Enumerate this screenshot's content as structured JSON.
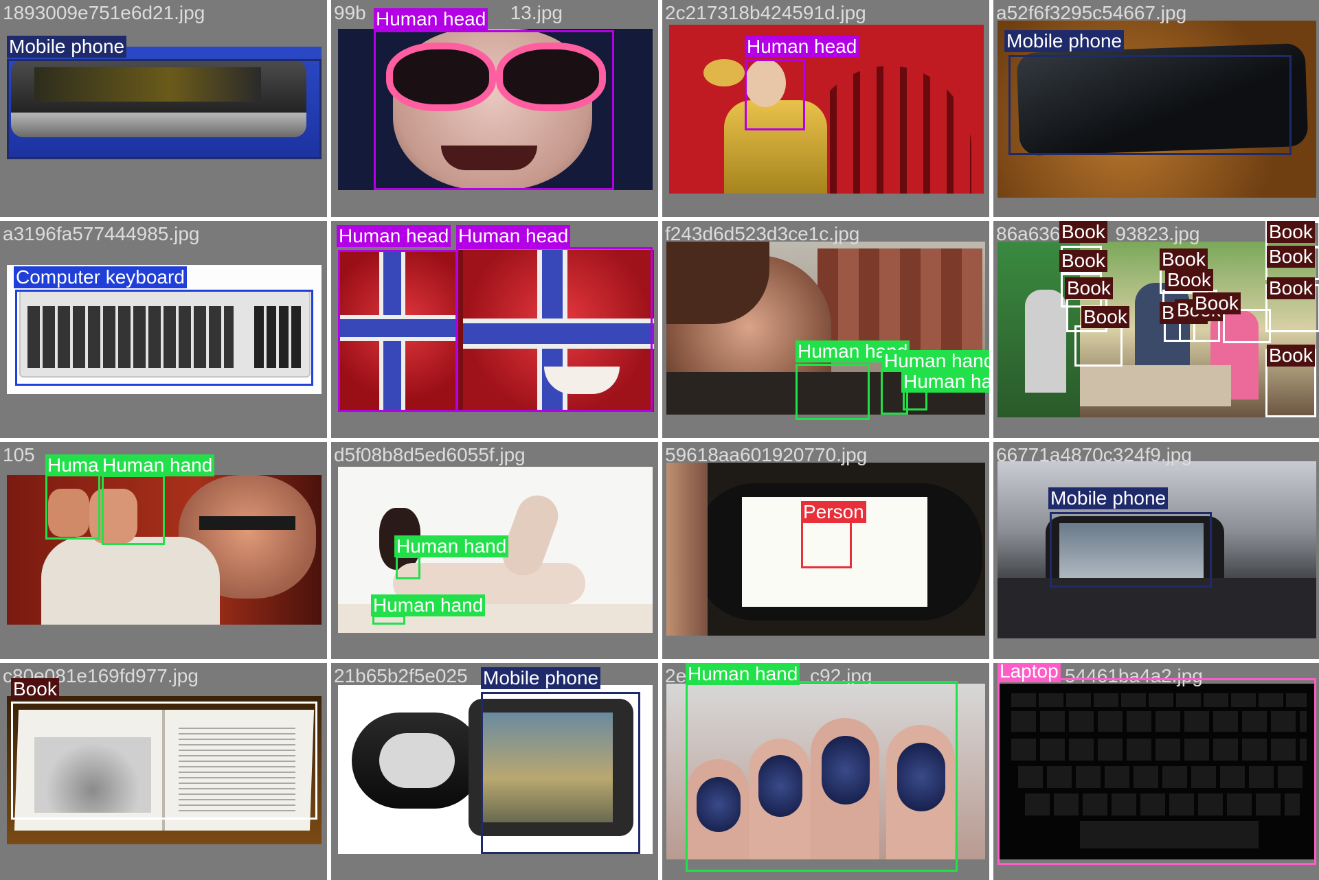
{
  "colors": {
    "mobile_phone": "#1f2a6b",
    "human_head": "#b400e6",
    "computer_keyboard": "#1f3fd8",
    "human_hand": "#22e04a",
    "book": "#4d1010",
    "person": "#e8303a",
    "laptop": "#ff5cc8"
  },
  "tiles": [
    {
      "filename": "1893009e751e6d21.jpg",
      "labels": [
        "Mobile phone"
      ]
    },
    {
      "filename": "99b",
      "filename_tail": "13.jpg",
      "labels": [
        "Human head"
      ]
    },
    {
      "filename": "2c217318b424591d.jpg",
      "labels": [
        "Human head"
      ]
    },
    {
      "filename": "a52f6f3295c54667.jpg",
      "labels": [
        "Mobile phone"
      ]
    },
    {
      "filename": "a3196fa577444985.jpg",
      "labels": [
        "Computer keyboard"
      ]
    },
    {
      "filename": "",
      "labels": [
        "Human head",
        "Human head"
      ]
    },
    {
      "filename": "f243d6d523d3ce1c.jpg",
      "labels": [
        "Human hand",
        "Human hand",
        "Human hand"
      ]
    },
    {
      "filename": "86a636",
      "filename_tail": "93823.jpg",
      "labels": [
        "Book",
        "Book",
        "Book",
        "Book",
        "Book",
        "Book",
        "Book",
        "Book",
        "Book",
        "Book",
        "Book",
        "Book",
        "Book"
      ]
    },
    {
      "filename": "105",
      "labels": [
        "Huma",
        "Human hand"
      ]
    },
    {
      "filename": "d5f08b8d5ed6055f.jpg",
      "labels": [
        "Human hand",
        "Human hand"
      ]
    },
    {
      "filename": "59618aa601920770.jpg",
      "labels": [
        "Person"
      ]
    },
    {
      "filename": "66771a4870c324f9.jpg",
      "labels": [
        "Mobile phone"
      ]
    },
    {
      "filename": "c80e081e169fd977.jpg",
      "labels": [
        "Book"
      ]
    },
    {
      "filename": "21b65b2f5e025",
      "labels": [
        "Mobile phone"
      ]
    },
    {
      "filename": "2e",
      "filename_tail": "c92.jpg",
      "labels": [
        "Human hand"
      ]
    },
    {
      "filename": "",
      "filename_tail": "54461ba4a2.jpg",
      "labels": [
        "Laptop"
      ]
    }
  ]
}
